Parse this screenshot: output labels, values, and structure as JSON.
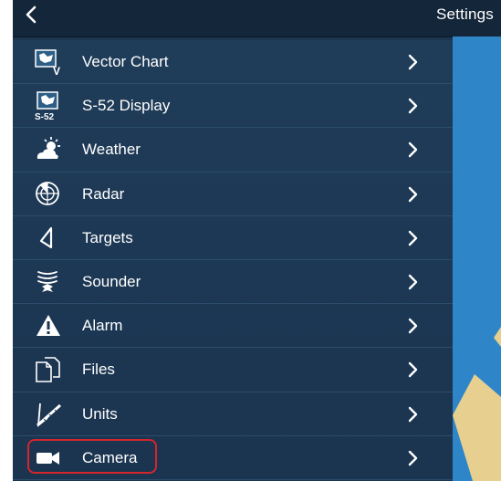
{
  "header": {
    "title": "Settings",
    "back_icon": "chevron-left-icon"
  },
  "menu": {
    "items": [
      {
        "label": "Vector Chart",
        "icon": "vector-chart-icon"
      },
      {
        "label": "S-52 Display",
        "icon": "s52-display-icon",
        "icon_text": "S-52"
      },
      {
        "label": "Weather",
        "icon": "weather-icon"
      },
      {
        "label": "Radar",
        "icon": "radar-icon"
      },
      {
        "label": "Targets",
        "icon": "targets-icon"
      },
      {
        "label": "Sounder",
        "icon": "sounder-icon"
      },
      {
        "label": "Alarm",
        "icon": "alarm-icon"
      },
      {
        "label": "Files",
        "icon": "files-icon"
      },
      {
        "label": "Units",
        "icon": "units-icon"
      },
      {
        "label": "Camera",
        "icon": "camera-icon",
        "highlighted": true
      }
    ]
  },
  "colors": {
    "header_bg": "#14263a",
    "menu_bg": "#1d3650",
    "divider": "#2d4d6c",
    "map_water": "#2e86c9",
    "map_land": "#e7cf8f",
    "highlight_border": "#d4262c"
  }
}
